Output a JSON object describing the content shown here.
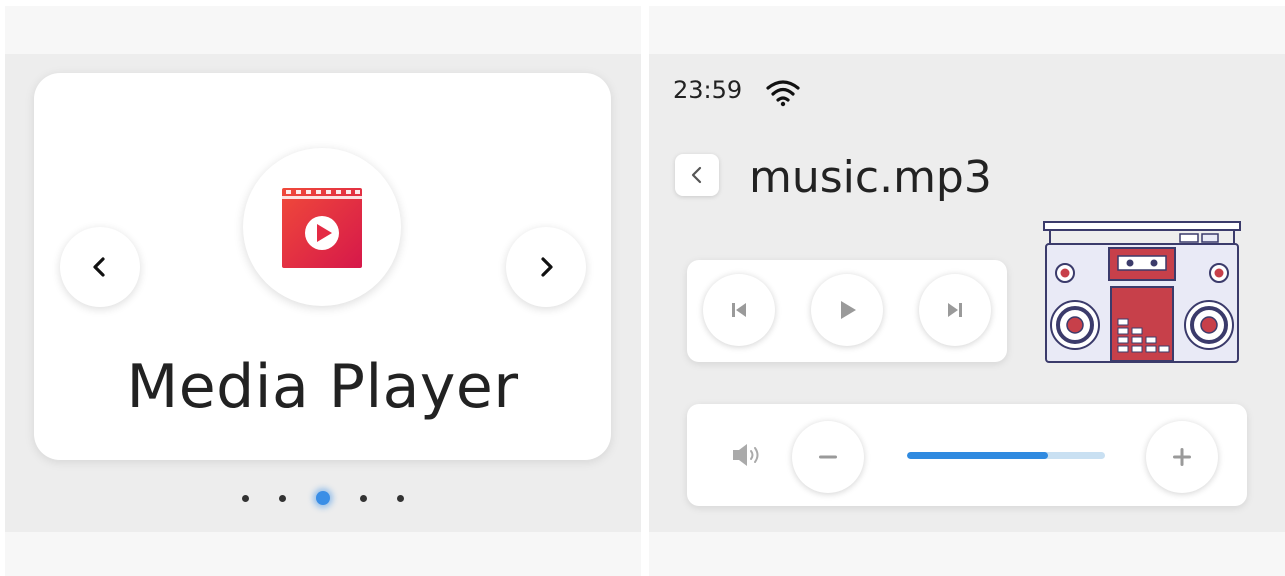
{
  "launcher": {
    "app_title": "Media Player",
    "app_icon": "video-play-icon",
    "prev_icon": "chevron-left-icon",
    "next_icon": "chevron-right-icon",
    "page_count": 5,
    "active_page": 3,
    "accent_color": "#3a8ee6",
    "icon_colors": [
      "#f04a3a",
      "#d6184a"
    ]
  },
  "player": {
    "status_time": "23:59",
    "status_icon": "wifi-icon",
    "back_icon": "chevron-left-icon",
    "file_name": "music.mp3",
    "illustration": "boombox-radio",
    "controls": {
      "prev_icon": "skip-previous-icon",
      "play_icon": "play-icon",
      "next_icon": "skip-next-icon"
    },
    "volume": {
      "speaker_icon": "speaker-icon",
      "down_icon": "minus-icon",
      "up_icon": "plus-icon",
      "level": 0.71,
      "fill_color": "#2f8ae0",
      "track_color": "#c9e0f2"
    }
  }
}
